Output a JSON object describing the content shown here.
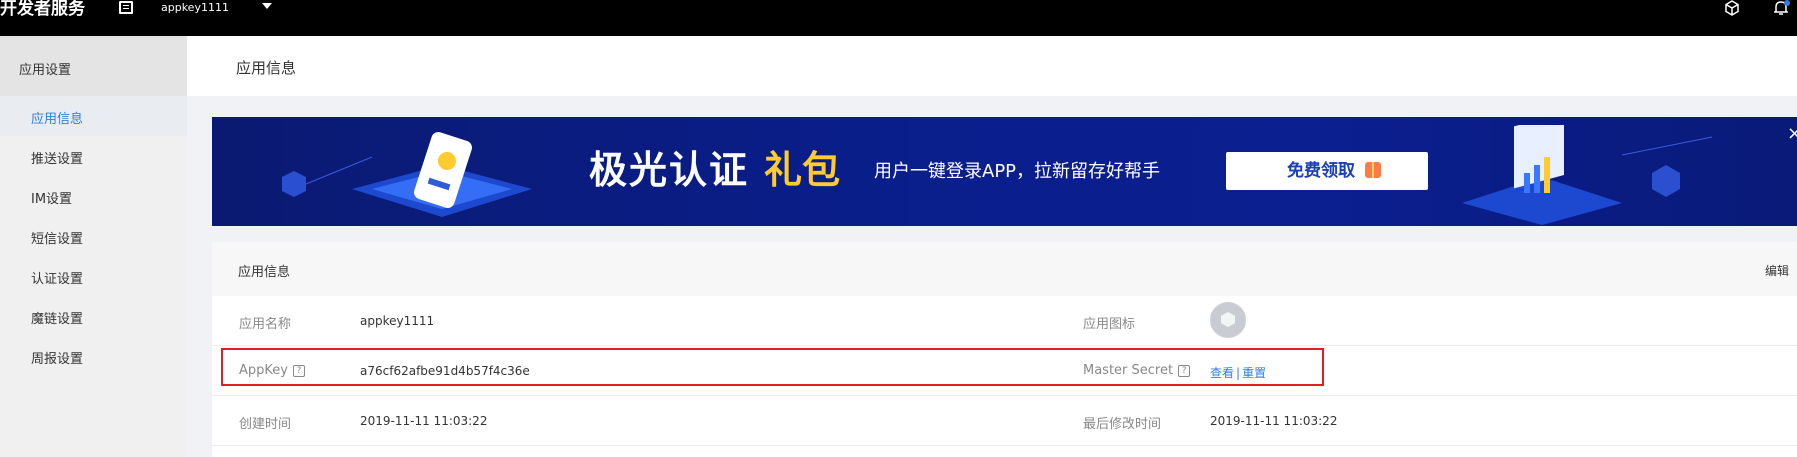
{
  "topbar": {
    "brand": "开发者服务",
    "app_selector": "appkey1111",
    "icons": [
      "doc-icon",
      "caret-down-icon",
      "cube-icon",
      "bell-icon"
    ]
  },
  "sidebar": {
    "header": "应用设置",
    "items": [
      {
        "label": "应用信息",
        "active": true
      },
      {
        "label": "推送设置"
      },
      {
        "label": "IM设置"
      },
      {
        "label": "短信设置"
      },
      {
        "label": "认证设置"
      },
      {
        "label": "魔链设置"
      },
      {
        "label": "周报设置"
      }
    ]
  },
  "main": {
    "page_title": "应用信息",
    "banner": {
      "title": "极光认证",
      "title_accent": "礼包",
      "subtitle": "用户一键登录APP，拉新留存好帮手",
      "button": "免费领取",
      "close": "×"
    },
    "panel": {
      "title": "应用信息",
      "edit": "编辑",
      "rows": [
        {
          "label_left": "应用名称",
          "value_left": "appkey1111",
          "label_right": "应用图标"
        },
        {
          "label_left": "AppKey",
          "value_left": "a76cf62afbe91d4b57f4c36e",
          "label_right": "Master Secret",
          "view": "查看",
          "sep": "|",
          "reset": "重置"
        },
        {
          "label_left": "创建时间",
          "value_left": "2019-11-11 11:03:22",
          "label_right": "最后修改时间",
          "value_right": "2019-11-11 11:03:22"
        }
      ],
      "help_glyph": "?"
    }
  },
  "colors": {
    "accent": "#2e7fe0",
    "highlight": "#e02020",
    "banner_bg": "#0a1e8c",
    "gift_yellow": "#ffcb2f"
  }
}
